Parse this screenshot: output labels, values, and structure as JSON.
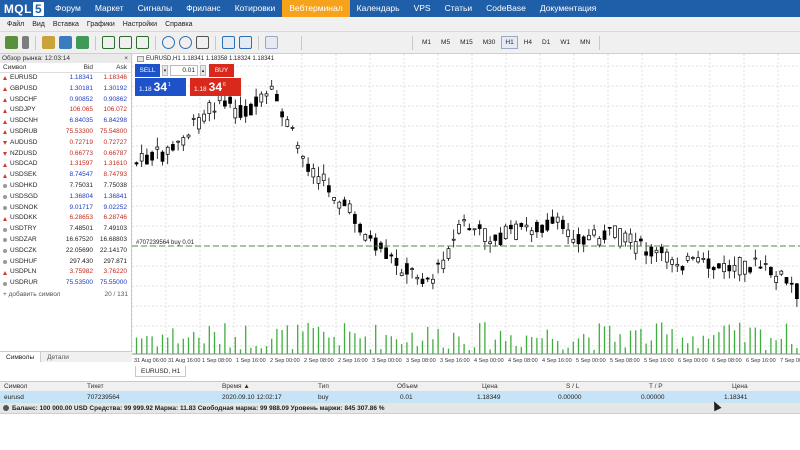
{
  "logo": {
    "text": "MQL",
    "num": "5"
  },
  "nav": [
    "Форум",
    "Маркет",
    "Сигналы",
    "Фриланс",
    "Котировки",
    "Вебтерминал",
    "Календарь",
    "VPS",
    "Статьи",
    "CodeBase",
    "Документация"
  ],
  "nav_active_index": 5,
  "menu": [
    "Файл",
    "Вид",
    "Вставка",
    "Графики",
    "Настройки",
    "Справка"
  ],
  "timeframes": [
    "M1",
    "M5",
    "M15",
    "M30",
    "H1",
    "H4",
    "D1",
    "W1",
    "MN"
  ],
  "timeframe_active": "H1",
  "market_watch": {
    "title": "Обзор рынка: 12:03:14",
    "col_symbol": "Символ",
    "col_bid": "Bid",
    "col_ask": "Ask",
    "rows": [
      {
        "symbol": "EURUSD",
        "bid": "1.18341",
        "ask": "1.18346",
        "dir": "up",
        "bidc": "blue",
        "askc": "red"
      },
      {
        "symbol": "GBPUSD",
        "bid": "1.30181",
        "ask": "1.30192",
        "dir": "up",
        "bidc": "blue",
        "askc": "blue"
      },
      {
        "symbol": "USDCHF",
        "bid": "0.90852",
        "ask": "0.90862",
        "dir": "up",
        "bidc": "blue",
        "askc": "blue"
      },
      {
        "symbol": "USDJPY",
        "bid": "106.065",
        "ask": "106.072",
        "dir": "up",
        "bidc": "red",
        "askc": "red"
      },
      {
        "symbol": "USDCNH",
        "bid": "6.84035",
        "ask": "6.84298",
        "dir": "up",
        "bidc": "blue",
        "askc": "blue"
      },
      {
        "symbol": "USDRUB",
        "bid": "75.53300",
        "ask": "75.54800",
        "dir": "up",
        "bidc": "red",
        "askc": "red"
      },
      {
        "symbol": "AUDUSD",
        "bid": "0.72719",
        "ask": "0.72727",
        "dir": "down",
        "bidc": "red",
        "askc": "red"
      },
      {
        "symbol": "NZDUSD",
        "bid": "0.66773",
        "ask": "0.66787",
        "dir": "down",
        "bidc": "red",
        "askc": "red"
      },
      {
        "symbol": "USDCAD",
        "bid": "1.31597",
        "ask": "1.31610",
        "dir": "up",
        "bidc": "red",
        "askc": "red"
      },
      {
        "symbol": "USDSEK",
        "bid": "8.74547",
        "ask": "8.74793",
        "dir": "up",
        "bidc": "blue",
        "askc": "red"
      },
      {
        "symbol": "USDHKD",
        "bid": "7.75031",
        "ask": "7.75038",
        "dir": "dot",
        "bidc": "black",
        "askc": "black"
      },
      {
        "symbol": "USDSGD",
        "bid": "1.36804",
        "ask": "1.36841",
        "dir": "dot",
        "bidc": "blue",
        "askc": "blue"
      },
      {
        "symbol": "USDNOK",
        "bid": "9.01717",
        "ask": "9.02252",
        "dir": "dot",
        "bidc": "blue",
        "askc": "blue"
      },
      {
        "symbol": "USDDKK",
        "bid": "6.28653",
        "ask": "6.28746",
        "dir": "up",
        "bidc": "red",
        "askc": "red"
      },
      {
        "symbol": "USDTRY",
        "bid": "7.48501",
        "ask": "7.49103",
        "dir": "dot",
        "bidc": "black",
        "askc": "black"
      },
      {
        "symbol": "USDZAR",
        "bid": "16.67520",
        "ask": "16.68803",
        "dir": "dot",
        "bidc": "black",
        "askc": "black"
      },
      {
        "symbol": "USDCZK",
        "bid": "22.05690",
        "ask": "22.14170",
        "dir": "dot",
        "bidc": "black",
        "askc": "black"
      },
      {
        "symbol": "USDHUF",
        "bid": "297.430",
        "ask": "297.871",
        "dir": "dot",
        "bidc": "black",
        "askc": "black"
      },
      {
        "symbol": "USDPLN",
        "bid": "3.75982",
        "ask": "3.76220",
        "dir": "up",
        "bidc": "red",
        "askc": "red"
      },
      {
        "symbol": "USDRUR",
        "bid": "75.53500",
        "ask": "75.55000",
        "dir": "dot",
        "bidc": "blue",
        "askc": "blue"
      }
    ],
    "add_label": "добавить символ",
    "count": "20 / 131",
    "tabs": [
      "Символы",
      "Детали"
    ]
  },
  "chart": {
    "info": "EURUSD,H1  1.18341 1.18358 1.18324 1.18341",
    "tab_label": "EURUSD, H1",
    "order_line_label": "#707239564 buy 0.01",
    "trade": {
      "sell_label": "SELL",
      "buy_label": "BUY",
      "lot": "0.01",
      "sell_small": "1.18",
      "sell_big": "34",
      "sell_sup": "1",
      "buy_small": "1.18",
      "buy_big": "34",
      "buy_sup": "6"
    },
    "x_labels": [
      "31 Aug 06:00",
      "31 Aug 16:00",
      "1 Sep 08:00",
      "1 Sep 16:00",
      "2 Sep 00:00",
      "2 Sep 08:00",
      "2 Sep 16:00",
      "3 Sep 00:00",
      "3 Sep 08:00",
      "3 Sep 16:00",
      "4 Sep 00:00",
      "4 Sep 08:00",
      "4 Sep 16:00",
      "5 Sep 00:00",
      "5 Sep 08:00",
      "5 Sep 16:00",
      "6 Sep 00:00",
      "6 Sep 08:00",
      "6 Sep 16:00",
      "7 Sep 00:00",
      "7 Sep 08:00",
      "7 Sep 16:00",
      "8 Sep 00:00",
      "8 Sep 08:00",
      "8 Sep 16:00"
    ]
  },
  "terminal": {
    "headers": [
      "Символ",
      "Тикет",
      "Время ▲",
      "Тип",
      "Объем",
      "Цена",
      "S / L",
      "T / P",
      "Цена"
    ],
    "row": [
      "eurusd",
      "707239564",
      "2020.09.10 12:02:17",
      "buy",
      "0.01",
      "1.18349",
      "0.00000",
      "0.00000",
      "1.18341"
    ],
    "balance": "Баланс: 100 000.00 USD  Средства: 99 999.92  Маржа: 11.83  Свободная маржа: 99 988.09  Уровень маржи: 845 307.86 %"
  }
}
